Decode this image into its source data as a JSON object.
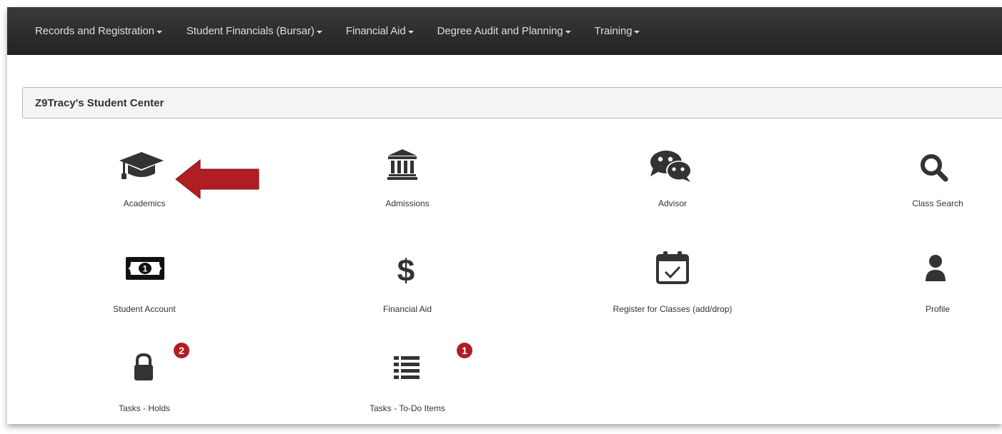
{
  "nav": {
    "items": [
      {
        "label": "Records and Registration"
      },
      {
        "label": "Student Financials (Bursar)"
      },
      {
        "label": "Financial Aid"
      },
      {
        "label": "Degree Audit and Planning"
      },
      {
        "label": "Training"
      }
    ]
  },
  "page": {
    "title": "Z9Tracy's Student Center"
  },
  "tiles": [
    {
      "label": "Academics",
      "icon": "graduation-cap-icon"
    },
    {
      "label": "Admissions",
      "icon": "institution-icon"
    },
    {
      "label": "Advisor",
      "icon": "chat-bubbles-icon"
    },
    {
      "label": "Class Search",
      "icon": "search-icon"
    },
    {
      "label": "Student Account",
      "icon": "money-bill-icon"
    },
    {
      "label": "Financial Aid",
      "icon": "dollar-icon"
    },
    {
      "label": "Register for Classes (add/drop)",
      "icon": "calendar-check-icon"
    },
    {
      "label": "Profile",
      "icon": "user-icon"
    },
    {
      "label": "Tasks - Holds",
      "icon": "lock-icon",
      "badge": "2"
    },
    {
      "label": "Tasks - To-Do Items",
      "icon": "list-icon",
      "badge": "1"
    }
  ],
  "colors": {
    "navbar": "#2b2b2b",
    "icon": "#333333",
    "badge": "#b01e23",
    "arrow": "#b01e23"
  }
}
